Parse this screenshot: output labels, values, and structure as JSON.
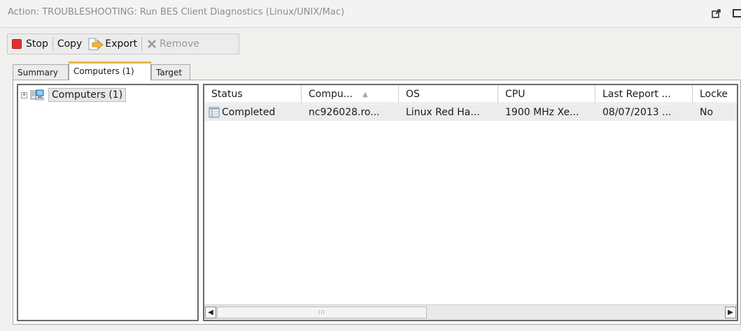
{
  "window": {
    "title": "Action: TROUBLESHOOTING: Run BES Client Diagnostics (Linux/UNIX/Mac)",
    "icons": [
      "undock-icon",
      "maximize-icon"
    ]
  },
  "toolbar": {
    "stop_label": "Stop",
    "copy_label": "Copy",
    "export_label": "Export",
    "remove_label": "Remove"
  },
  "tabs": [
    {
      "label": "Summary",
      "active": false
    },
    {
      "label": "Computers (1)",
      "active": true
    },
    {
      "label": "Target",
      "active": false
    }
  ],
  "tree": {
    "root_label": "Computers (1)"
  },
  "grid": {
    "columns": [
      "Status",
      "Compu...",
      "OS",
      "CPU",
      "Last Report ...",
      "Locke"
    ],
    "sort_column": "Compu...",
    "rows": [
      {
        "status": "Completed",
        "computer": "nc926028.ro...",
        "os": "Linux Red Ha...",
        "cpu": "1900 MHz Xe...",
        "last_report": "08/07/2013 ...",
        "locked": "No"
      }
    ],
    "scroll_grip": "III"
  },
  "colors": {
    "stop_red": "#e0322d",
    "active_tab_accent": "#e7b64a"
  }
}
